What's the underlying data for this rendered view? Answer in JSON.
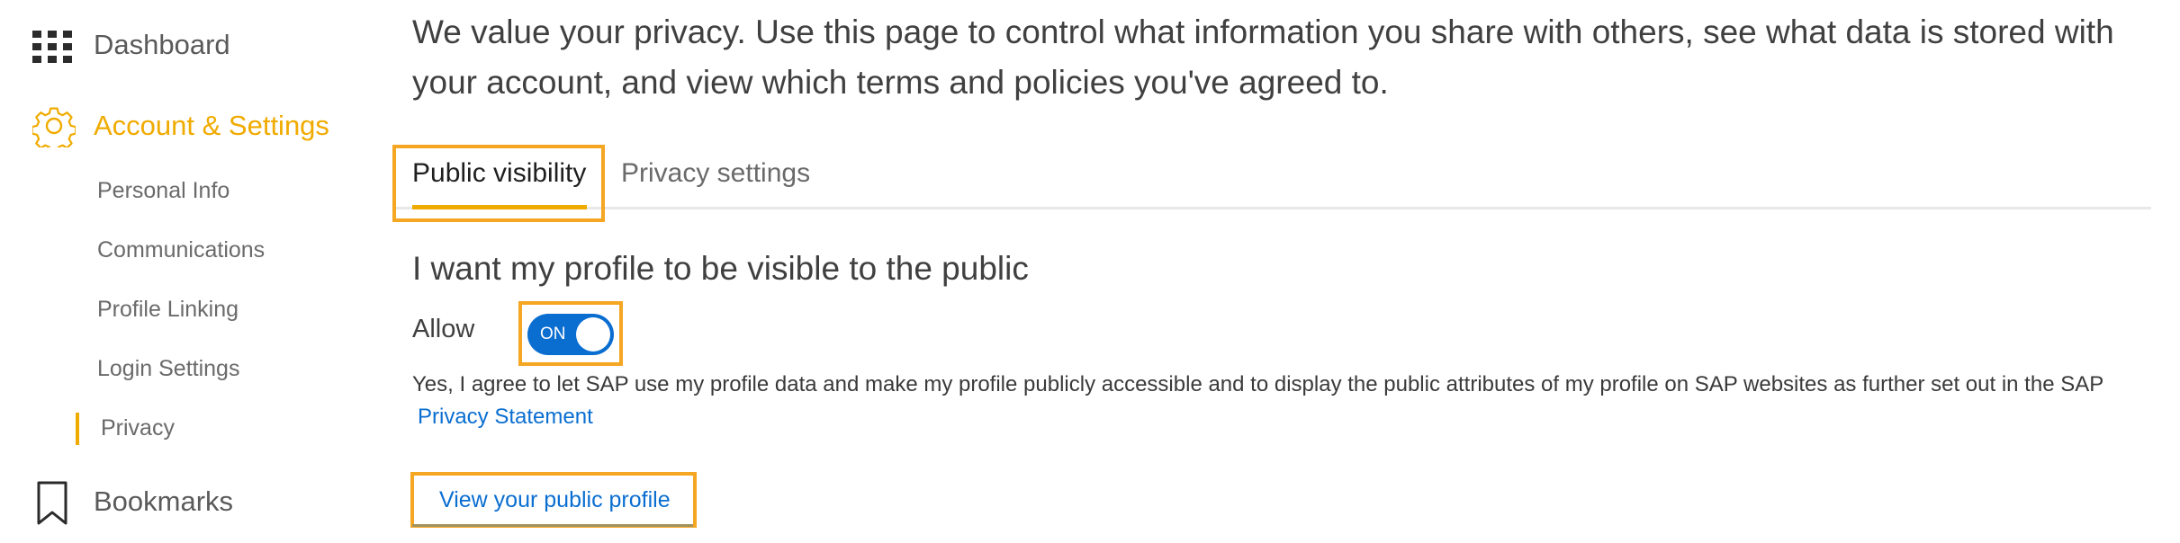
{
  "sidebar": {
    "dashboard": {
      "label": "Dashboard",
      "icon": "grid-icon"
    },
    "account": {
      "label": "Account & Settings",
      "icon": "gear-icon",
      "color": "#f0ab00"
    },
    "sub_items": [
      {
        "label": "Personal Info"
      },
      {
        "label": "Communications"
      },
      {
        "label": "Profile Linking"
      },
      {
        "label": "Login Settings"
      },
      {
        "label": "Privacy",
        "active": true
      }
    ],
    "bookmarks": {
      "label": "Bookmarks",
      "icon": "bookmark-icon"
    }
  },
  "main": {
    "intro": "We value your privacy. Use this page to control what information you share with others, see what data is stored with your account, and view which terms and policies you've agreed to.",
    "tabs": [
      {
        "label": "Public visibility",
        "active": true
      },
      {
        "label": "Privacy settings",
        "active": false
      }
    ],
    "section_heading": "I want my profile to be visible to the public",
    "allow_label": "Allow",
    "toggle": {
      "state_label": "ON",
      "on": true
    },
    "consent_text": "Yes, I agree to let SAP use my profile data and make my profile publicly accessible and to display the public attributes of my profile on SAP websites as further set out in the SAP",
    "privacy_statement_link": "Privacy Statement",
    "view_public_profile_link": "View your public profile"
  },
  "colors": {
    "accent": "#f0ab00",
    "link": "#0a6ed1",
    "focus_outline": "#f5a623"
  }
}
